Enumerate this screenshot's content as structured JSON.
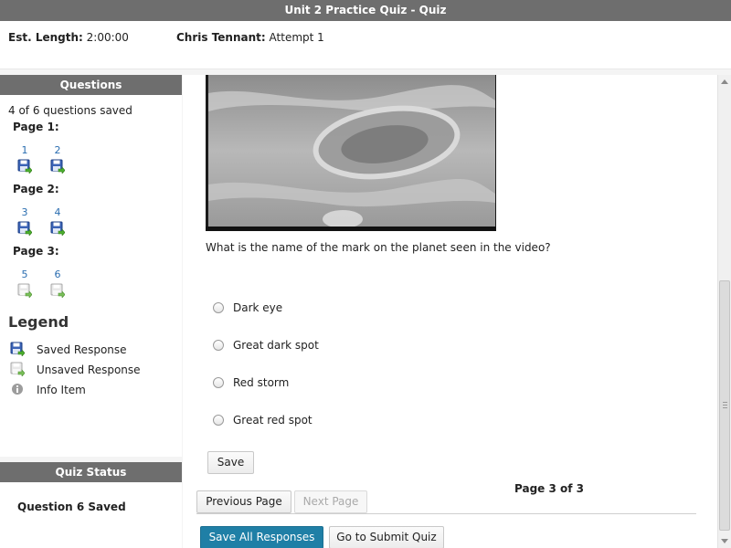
{
  "title": "Unit 2 Practice Quiz - Quiz",
  "info": {
    "est_length_label": "Est. Length:",
    "est_length_value": "2:00:00",
    "user_name": "Chris Tennant:",
    "attempt": "Attempt 1"
  },
  "sidebar": {
    "questions_header": "Questions",
    "saved_count": "4 of 6 questions saved",
    "pages": [
      {
        "label": "Page 1:",
        "questions": [
          {
            "num": "1",
            "state": "saved"
          },
          {
            "num": "2",
            "state": "saved"
          }
        ]
      },
      {
        "label": "Page 2:",
        "questions": [
          {
            "num": "3",
            "state": "saved"
          },
          {
            "num": "4",
            "state": "saved"
          }
        ]
      },
      {
        "label": "Page 3:",
        "questions": [
          {
            "num": "5",
            "state": "unsaved"
          },
          {
            "num": "6",
            "state": "unsaved"
          }
        ]
      }
    ],
    "legend": {
      "title": "Legend",
      "items": [
        {
          "icon": "saved-response-icon",
          "label": "Saved Response"
        },
        {
          "icon": "unsaved-response-icon",
          "label": "Unsaved Response"
        },
        {
          "icon": "info-icon",
          "label": "Info Item"
        }
      ]
    },
    "status_header": "Quiz Status",
    "status_text": "Question 6 Saved"
  },
  "main": {
    "question": "What is the name of the mark on the planet seen in the video?",
    "options": [
      "Dark eye",
      "Great dark spot",
      "Red storm",
      "Great red spot"
    ],
    "save_label": "Save",
    "previous_label": "Previous Page",
    "next_label": "Next Page",
    "page_indicator": "Page 3 of 3",
    "save_all_label": "Save All Responses",
    "submit_label": "Go to Submit Quiz"
  },
  "colors": {
    "header_bg": "#6e6e6e",
    "link": "#2a6db0",
    "primary_button": "#1f7fa6"
  }
}
